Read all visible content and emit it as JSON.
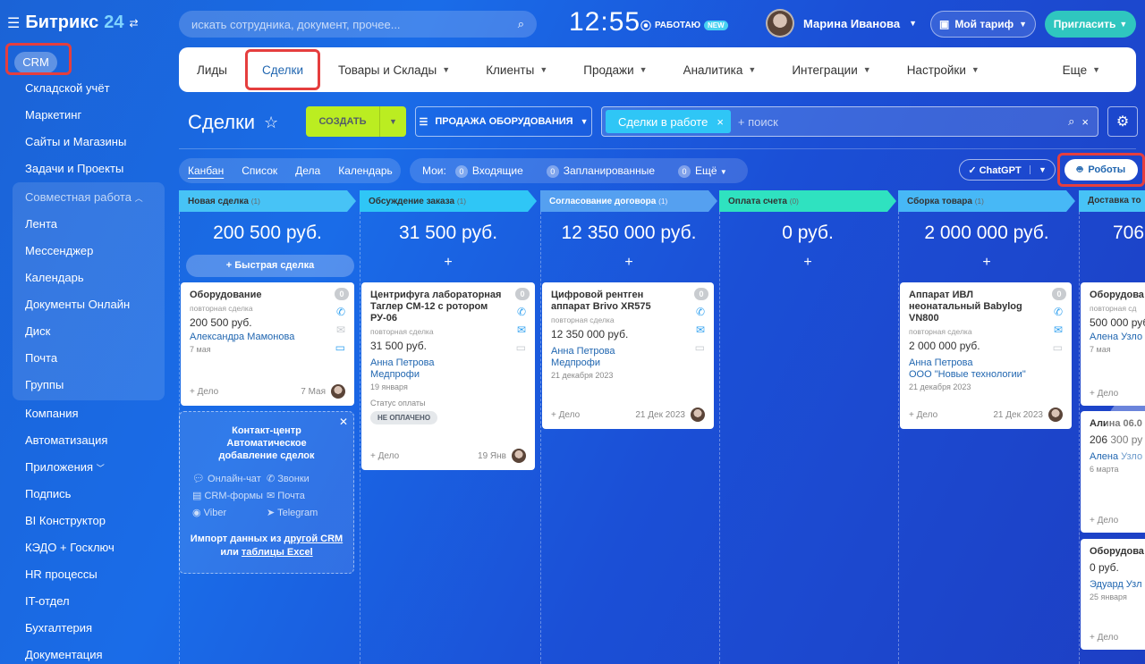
{
  "app": {
    "name": "Битрикс",
    "version": "24"
  },
  "search": {
    "placeholder": "искать сотрудника, документ, прочее..."
  },
  "clock": "12:55",
  "work_status": {
    "label": "РАБОТАЮ",
    "badge": "NEW"
  },
  "user": {
    "name": "Марина Иванова"
  },
  "tarif_label": "Мой тариф",
  "invite_label": "Пригласить",
  "sidebar": {
    "crm": "CRM",
    "items_top": [
      "Складской учёт",
      "Маркетинг",
      "Сайты и Магазины",
      "Задачи и Проекты"
    ],
    "group_title": "Совместная работа",
    "group_items": [
      "Лента",
      "Мессенджер",
      "Календарь",
      "Документы Онлайн",
      "Диск",
      "Почта",
      "Группы"
    ],
    "items_bottom": [
      "Компания",
      "Автоматизация",
      "Приложения",
      "Подпись",
      "BI Конструктор",
      "КЭДО + Госключ",
      "HR процессы",
      "IT-отдел",
      "Бухгалтерия",
      "Документация"
    ]
  },
  "nav": {
    "leads": "Лиды",
    "deals": "Сделки",
    "goods": "Товары и Склады",
    "clients": "Клиенты",
    "sales": "Продажи",
    "analytics": "Аналитика",
    "integrations": "Интеграции",
    "settings": "Настройки",
    "more": "Еще"
  },
  "page": {
    "title": "Сделки"
  },
  "create_label": "СОЗДАТЬ",
  "funnel_label": "ПРОДАЖА ОБОРУДОВАНИЯ",
  "filter": {
    "tag": "Сделки в работе",
    "placeholder": "+ поиск"
  },
  "views": {
    "kanban": "Канбан",
    "list": "Список",
    "activities": "Дела",
    "calendar": "Календарь"
  },
  "my": {
    "label": "Мои:",
    "incoming": "Входящие",
    "incoming_count": "0",
    "planned": "Запланированные",
    "planned_count": "0",
    "more": "Ещё",
    "more_count": "0"
  },
  "chatgpt_label": "ChatGPT",
  "robots_label": "Роботы",
  "colors": {
    "accent": "#2066b0",
    "create": "#bbed21",
    "invite": "#2fc6bf"
  },
  "stages": [
    {
      "name": "Новая сделка",
      "count": "(1)",
      "sum": "200 500 руб.",
      "color": "#47c3f6"
    },
    {
      "name": "Обсуждение заказа",
      "count": "(1)",
      "sum": "31 500 руб.",
      "color": "#2fc6f6"
    },
    {
      "name": "Согласование договора",
      "count": "(1)",
      "sum": "12 350 000 руб.",
      "color": "#55a0f0"
    },
    {
      "name": "Оплата счета",
      "count": "(0)",
      "sum": "0 руб.",
      "color": "#2fe2c0"
    },
    {
      "name": "Сборка товара",
      "count": "(1)",
      "sum": "2 000 000 руб.",
      "color": "#47b8f6"
    },
    {
      "name": "Доставка то",
      "count": "",
      "sum": "706",
      "color": "#47c3f6"
    }
  ],
  "quick_deal": "Быстрая сделка",
  "deals": [
    {
      "title": "Оборудование",
      "sub": "повторная сделка",
      "price": "200 500 руб.",
      "contact": "Александра Мамонова",
      "company": "",
      "date": "7 мая",
      "foot_date": "7 Мая",
      "badge": "0"
    },
    {
      "title": "Центрифуга лабораторная Таглер СМ-12 с ротором РУ-06",
      "sub": "повторная сделка",
      "price": "31 500 руб.",
      "contact": "Анна Петрова",
      "company": "Медпрофи",
      "date": "19 января",
      "foot_date": "19 Янв",
      "badge": "0",
      "payment_label": "Статус оплаты",
      "payment_value": "НЕ ОПЛАЧЕНО"
    },
    {
      "title": "Цифровой рентген аппарат Brivo XR575",
      "sub": "повторная сделка",
      "price": "12 350 000 руб.",
      "contact": "Анна Петрова",
      "company": "Медпрофи",
      "date": "21 декабря 2023",
      "foot_date": "21 Дек 2023",
      "badge": "0"
    },
    {
      "title": "Аппарат ИВЛ неонатальный Babylog VN800",
      "sub": "повторная сделка",
      "price": "2 000 000 руб.",
      "contact": "Анна Петрова",
      "company": "ООО \"Новые технологии\"",
      "date": "21 декабря 2023",
      "foot_date": "21 Дек 2023",
      "badge": "0"
    },
    {
      "title": "Оборудова",
      "sub": "повторная сд",
      "price": "500 000 руб",
      "contact": "Алена Узло",
      "date": "7 мая"
    },
    {
      "title": "Алина 06.0",
      "price": "206 300 ру",
      "contact": "Алена Узло",
      "date": "6 марта"
    },
    {
      "title": "Оборудова",
      "price": "0 руб.",
      "contact": "Эдуард Узл",
      "date": "25 января"
    }
  ],
  "add_task": "+ Дело",
  "contact_center": {
    "title": "Контакт-центр",
    "subtitle": "Автоматическое добавление сделок",
    "channels": [
      "Онлайн-чат",
      "Звонки",
      "CRM-формы",
      "Почта",
      "Viber",
      "Telegram"
    ],
    "import_a": "Импорт данных из",
    "import_link1": "другой CRM",
    "import_b": "или",
    "import_link2": "таблицы Excel"
  }
}
